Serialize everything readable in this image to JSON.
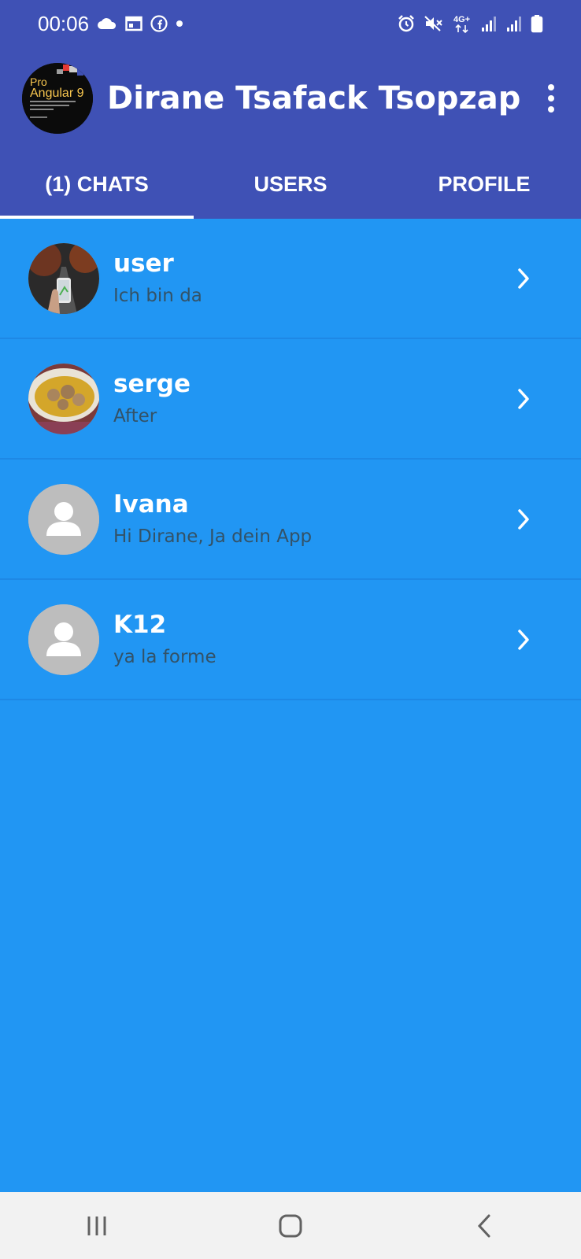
{
  "status_bar": {
    "time": "00:06",
    "left_icons": [
      "cloud-icon",
      "calendar-icon",
      "facebook-icon",
      "dot-icon"
    ],
    "right_icons": [
      "alarm-icon",
      "mute-icon",
      "network-4g-icon",
      "signal-icon",
      "signal-icon",
      "battery-icon"
    ],
    "network_label": "4G+"
  },
  "app_bar": {
    "avatar_text_line1": "Pro",
    "avatar_text_line2": "Angular 9",
    "title": "Dirane Tsafack Tsopzap",
    "menu_icon": "more-vert-icon"
  },
  "tabs": [
    {
      "label": "(1) CHATS",
      "active": true
    },
    {
      "label": "USERS",
      "active": false
    },
    {
      "label": "PROFILE",
      "active": false
    }
  ],
  "chats": [
    {
      "name": "user",
      "message": "Ich bin da",
      "avatar": "photo-road-phone"
    },
    {
      "name": "serge",
      "message": "After",
      "avatar": "photo-soup"
    },
    {
      "name": "Ivana",
      "message": "Hi Dirane, Ja dein App",
      "avatar": "default-person-icon"
    },
    {
      "name": "K12",
      "message": "ya la forme",
      "avatar": "default-person-icon"
    }
  ],
  "nav_bar": {
    "buttons": [
      "recent-apps-icon",
      "home-icon",
      "back-icon"
    ]
  },
  "colors": {
    "primary": "#3F51B5",
    "background": "#2196F3",
    "nav_bar": "#F2F2F2"
  }
}
